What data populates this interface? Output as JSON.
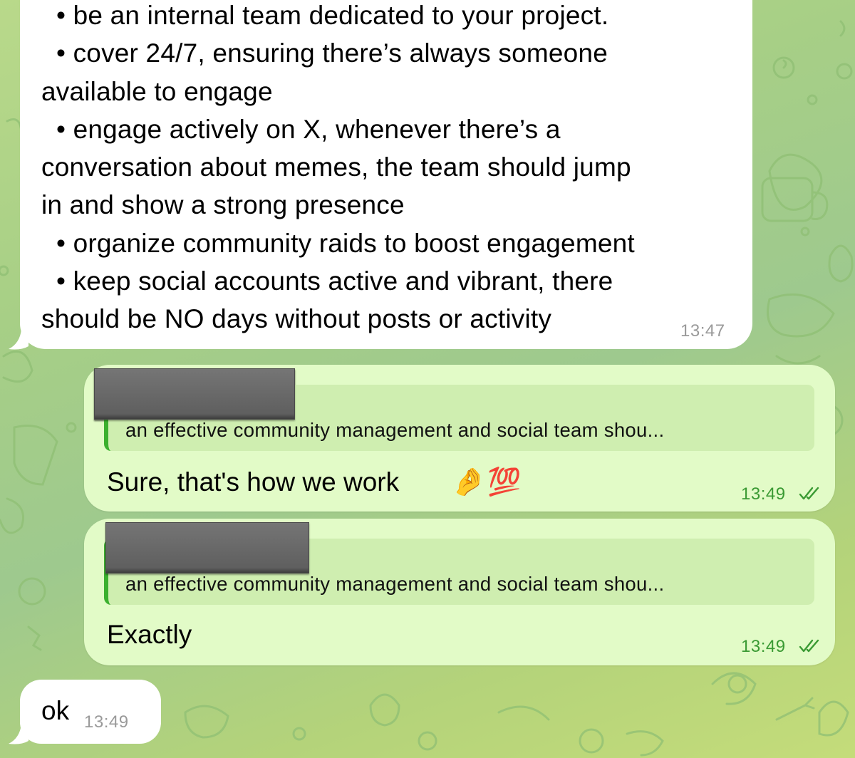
{
  "messages": [
    {
      "direction": "incoming",
      "lines": [
        "  • be an internal team dedicated to your project.",
        "  • cover 24/7, ensuring there’s always someone",
        "available to engage",
        "  • engage actively on X, whenever there’s a",
        "conversation about memes, the team should jump",
        "in and show a strong presence",
        "  • organize community raids to boost engagement",
        "  • keep social accounts active and vibrant, there",
        "should be NO days without posts or activity"
      ],
      "time": "13:47"
    },
    {
      "direction": "outgoing",
      "quote_text": "an effective community management and social team shou...",
      "text": "Sure, that's how we work",
      "emojis": [
        "pinching-hand-emoji",
        "hundred-points-emoji"
      ],
      "emoji_glyphs": [
        "🤌",
        "💯"
      ],
      "time": "13:49",
      "status": "read"
    },
    {
      "direction": "outgoing",
      "quote_text": "an effective community management and social team shou...",
      "text": "Exactly",
      "time": "13:49",
      "status": "read"
    },
    {
      "direction": "incoming",
      "text": "ok",
      "time": "13:49"
    }
  ],
  "colors": {
    "incoming_bubble": "#ffffff",
    "outgoing_bubble": "#e2fbc7",
    "quote_accent": "#3bb02e",
    "outgoing_time": "#3a9a33",
    "incoming_time": "#9a9a9a"
  }
}
